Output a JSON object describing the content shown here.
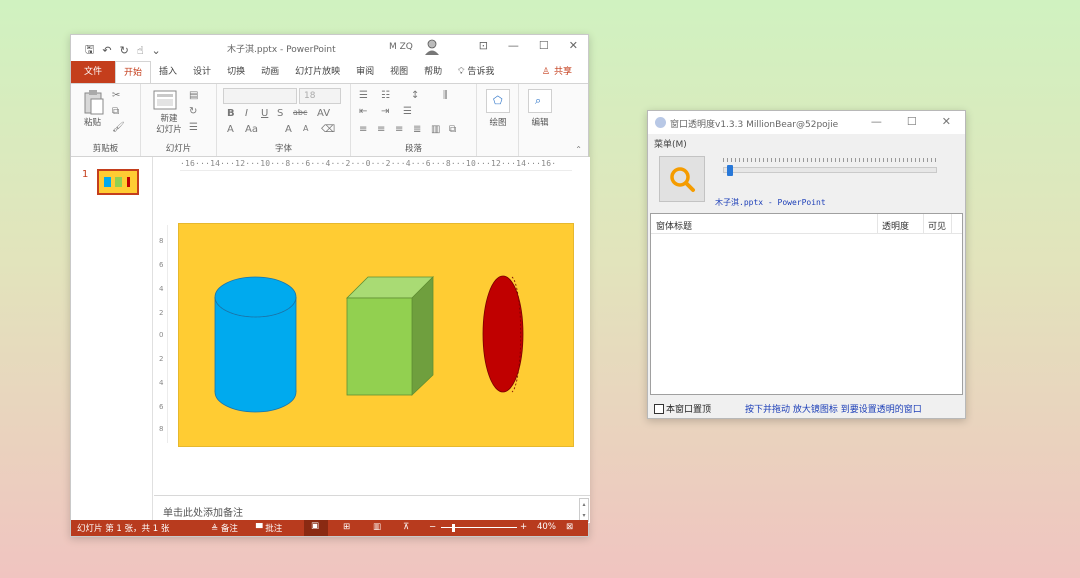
{
  "powerpoint": {
    "quick_access": {
      "save": "🖫",
      "undo": "↶",
      "redo": "↻",
      "touch": "☝",
      "more": "⌄"
    },
    "doc_title": "木子淇.pptx  -  PowerPoint",
    "user": "M ZQ",
    "window_buttons": {
      "ribbon_opts": "⊡",
      "minimize": "—",
      "maximize": "☐",
      "close": "✕"
    },
    "tabs": [
      "文件",
      "开始",
      "插入",
      "设计",
      "切换",
      "动画",
      "幻灯片放映",
      "审阅",
      "视图",
      "帮助"
    ],
    "tell_me": "告诉我",
    "share": "共享",
    "ribbon": {
      "clipboard": {
        "label": "剪贴板",
        "paste": "粘贴"
      },
      "slides": {
        "label": "幻灯片",
        "new_slide": "新建\n幻灯片"
      },
      "font": {
        "label": "字体",
        "size": "18"
      },
      "paragraph": {
        "label": "段落"
      },
      "drawing": {
        "label": "绘图"
      },
      "editing": {
        "label": "编辑"
      }
    },
    "ruler_text": "·16···14···12···10···8···6···4···2···0···2···4···6···8···10···12···14···16·",
    "ruler_v": [
      "8",
      "6",
      "4",
      "2",
      "0",
      "2",
      "4",
      "6",
      "8"
    ],
    "slide_number": "1",
    "notes_placeholder": "单击此处添加备注",
    "status": {
      "slide_info": "幻灯片 第 1 张，共 1 张",
      "notes": "≜ 备注",
      "comments": "▀ 批注",
      "zoom": "40%",
      "zoom_minus": "−",
      "zoom_plus": "+"
    },
    "colors": {
      "accent": "#c43e1c",
      "slide_bg": "#ffcc33",
      "cylinder": "#00aaee",
      "cube": "#92d050",
      "disc": "#c00000"
    }
  },
  "tool": {
    "title": "窗口透明度v1.3.3    MillionBear@52pojie",
    "window_buttons": {
      "minimize": "—",
      "maximize": "☐",
      "close": "✕"
    },
    "menu": "菜单(M)",
    "target": "木子淇.pptx - PowerPoint",
    "slider_value": 0.03,
    "columns": [
      "窗体标题",
      "透明度",
      "可见"
    ],
    "topmost_label": "本窗口置顶",
    "hint": "按下并拖动 放大镜图标 到要设置透明的窗口"
  }
}
